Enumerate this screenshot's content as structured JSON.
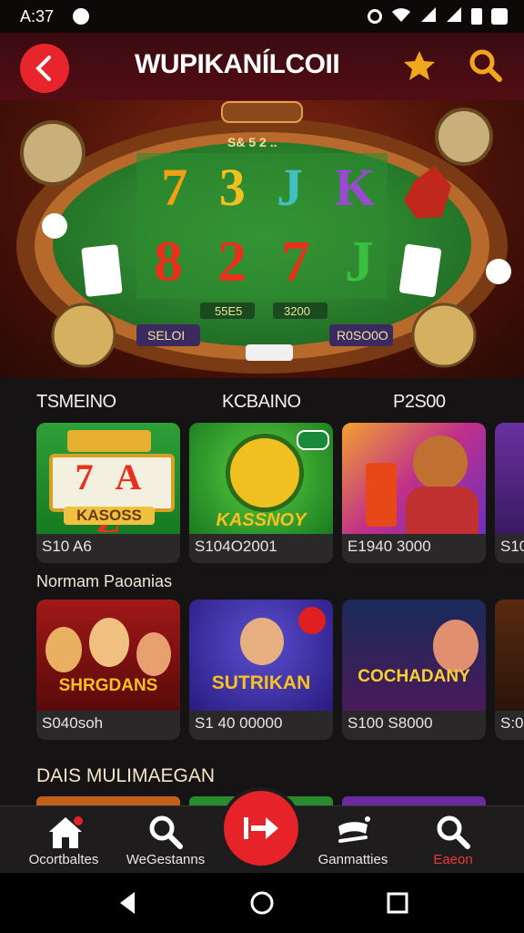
{
  "status": {
    "time": "A:37"
  },
  "app_bar": {
    "title": "WUPIKANÍLCOII"
  },
  "hero": {
    "reels_top": [
      "7",
      "3",
      "J",
      "K"
    ],
    "reels_bottom": [
      "8",
      "2",
      "7",
      "J"
    ],
    "sign": "S& 5 2 ..",
    "sub_a": "55E5",
    "sub_b": "3200",
    "btn_left": "SELOI",
    "btn_right": "R0SO0O"
  },
  "tabs": [
    "TSMEINO",
    "KCBAINO",
    "P2S00"
  ],
  "row1": [
    {
      "cap": "S10 A6",
      "art": "KASOSS",
      "reel": "7 A Z"
    },
    {
      "cap": "S104O2001",
      "art": "KASSNOY",
      "reel": ""
    },
    {
      "cap": "E1940 3000",
      "art": "",
      "reel": ""
    },
    {
      "cap": "S10",
      "art": "",
      "reel": ""
    }
  ],
  "section2": {
    "title": "Normam Paoanias"
  },
  "row2": [
    {
      "cap": "S040soh",
      "art": "SHRGDANS"
    },
    {
      "cap": "S1 40 00000",
      "art": "SUTRIKAN"
    },
    {
      "cap": "S100 S8000",
      "art": "COCHADANY"
    },
    {
      "cap": "S:0",
      "art": ""
    }
  ],
  "section3": {
    "title": "DAIS MULIMAEGAN"
  },
  "nav": [
    {
      "label": "Ocortbaltes"
    },
    {
      "label": "WeGestanns"
    },
    {
      "label": "Ganmatties"
    },
    {
      "label": "Eaeon"
    }
  ],
  "colors": {
    "accent": "#e52329",
    "brand_dark": "#3a0b10",
    "active_nav": "#e83a3a"
  },
  "icons": [
    "back-arrow-icon",
    "star-icon",
    "search-icon",
    "home-icon",
    "play-icon"
  ]
}
